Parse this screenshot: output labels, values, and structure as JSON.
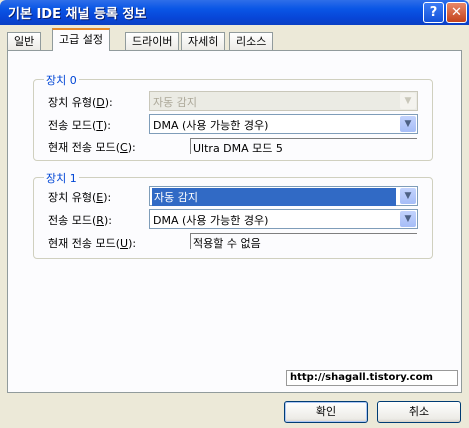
{
  "window": {
    "title": "기본 IDE 채널 등록 정보",
    "help_glyph": "?",
    "close_glyph": "✕"
  },
  "tabs": [
    {
      "label": "일반",
      "active": false
    },
    {
      "label": "고급 설정",
      "active": true
    },
    {
      "label": "드라이버",
      "active": false
    },
    {
      "label": "자세히",
      "active": false
    },
    {
      "label": "리소스",
      "active": false
    }
  ],
  "device0": {
    "title": "장치 0",
    "device_type": {
      "label_pre": "장치 유형(",
      "hotkey": "D",
      "label_post": "):",
      "value": "자동 감지",
      "disabled": true
    },
    "transfer_mode": {
      "label_pre": "전송 모드(",
      "hotkey": "T",
      "label_post": "):",
      "value": "DMA (사용 가능한 경우)"
    },
    "current_mode": {
      "label_pre": "현재 전송 모드(",
      "hotkey": "C",
      "label_post": "):",
      "value": "Ultra DMA 모드 5"
    }
  },
  "device1": {
    "title": "장치 1",
    "device_type": {
      "label_pre": "장치 유형(",
      "hotkey": "E",
      "label_post": "):",
      "value": "자동 감지",
      "selected": true
    },
    "transfer_mode": {
      "label_pre": "전송 모드(",
      "hotkey": "R",
      "label_post": "):",
      "value": "DMA (사용 가능한 경우)"
    },
    "current_mode": {
      "label_pre": "현재 전송 모드(",
      "hotkey": "U",
      "label_post": "):",
      "value": "적용할 수 없음"
    }
  },
  "watermark": "http://shagall.tistory.com",
  "buttons": {
    "ok": "확인",
    "cancel": "취소"
  },
  "colors": {
    "title_bar": "#0a56e6",
    "group_title": "#0046d5",
    "selection": "#316ac5",
    "active_tab_accent": "#e68b2c"
  }
}
